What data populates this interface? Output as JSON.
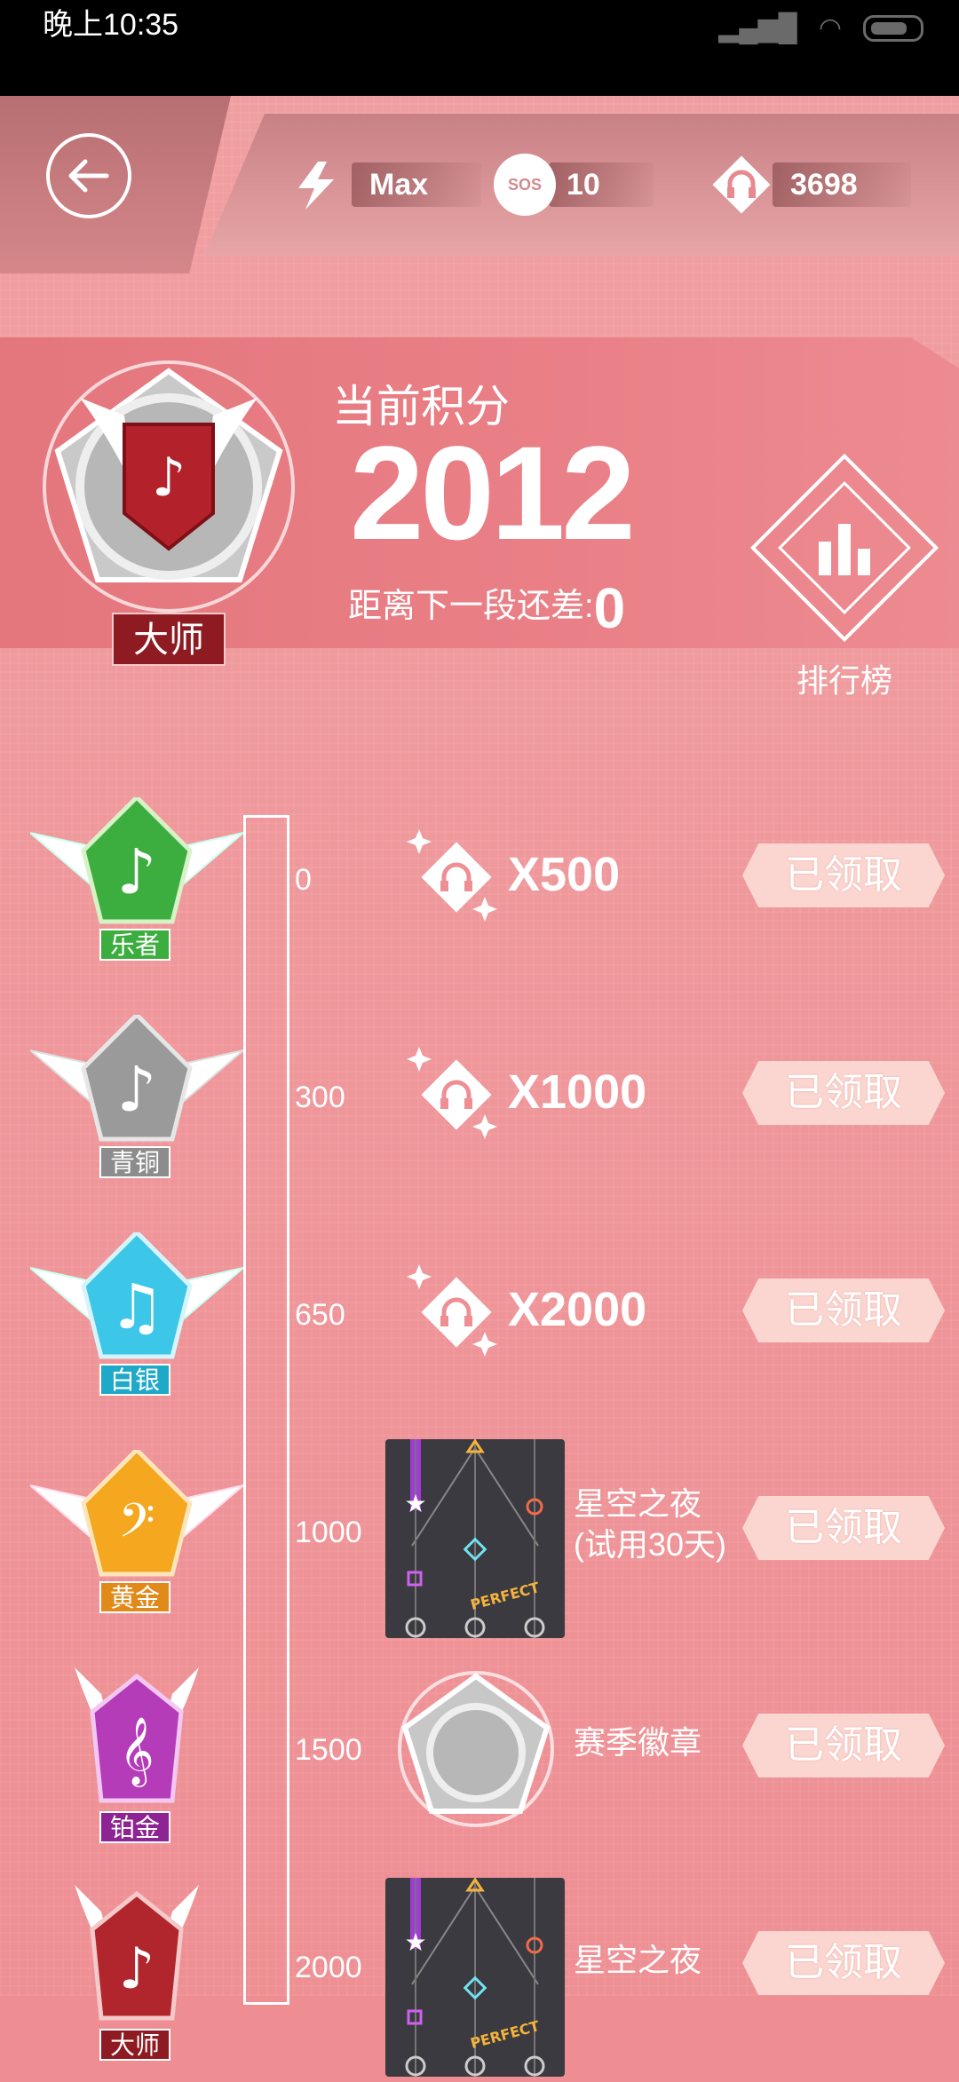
{
  "status_bar": {
    "time": "晚上10:35"
  },
  "top_bar": {
    "energy": "Max",
    "sos_icon_text": "SOS",
    "sos": "10",
    "coins": "3698"
  },
  "score_panel": {
    "rank_label": "大师",
    "title": "当前积分",
    "score": "2012",
    "next_label": "距离下一段还差:",
    "next_value": "0",
    "leaderboard_label": "排行榜"
  },
  "tiers": [
    {
      "name": "乐者",
      "score": "0",
      "reward_count": "X500",
      "button": "已领取",
      "color": "#3cae3f"
    },
    {
      "name": "青铜",
      "score": "300",
      "reward_count": "X1000",
      "button": "已领取",
      "color": "#9a9a9a"
    },
    {
      "name": "白银",
      "score": "650",
      "reward_count": "X2000",
      "button": "已领取",
      "color": "#1fa9c9"
    },
    {
      "name": "黄金",
      "score": "1000",
      "reward_name": "星空之夜\n(试用30天)",
      "button": "已领取",
      "color": "#e18a1a"
    },
    {
      "name": "铂金",
      "score": "1500",
      "reward_name": "赛季徽章",
      "button": "已领取",
      "color": "#a52aa8"
    },
    {
      "name": "大师",
      "score": "2000",
      "reward_name": "星空之夜",
      "button": "已领取",
      "color": "#b0262c"
    }
  ]
}
